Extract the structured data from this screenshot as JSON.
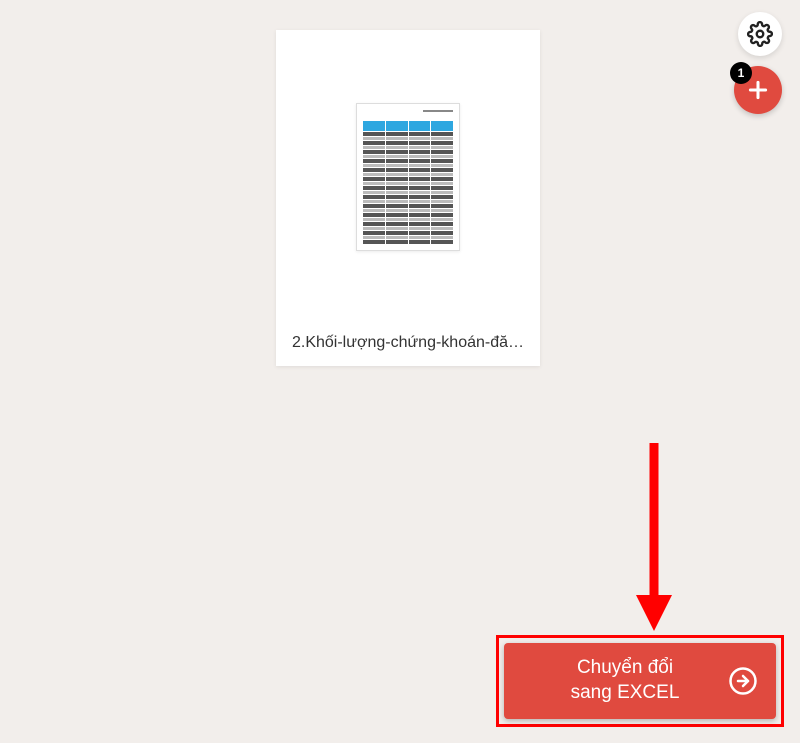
{
  "settings": {
    "icon": "gear"
  },
  "add": {
    "icon": "plus",
    "badge": "1"
  },
  "file": {
    "name": "2.Khối-lượng-chứng-khoán-đă…"
  },
  "convert": {
    "line1": "Chuyển đổi",
    "line2": "sang EXCEL",
    "icon": "arrow-right-circle"
  }
}
